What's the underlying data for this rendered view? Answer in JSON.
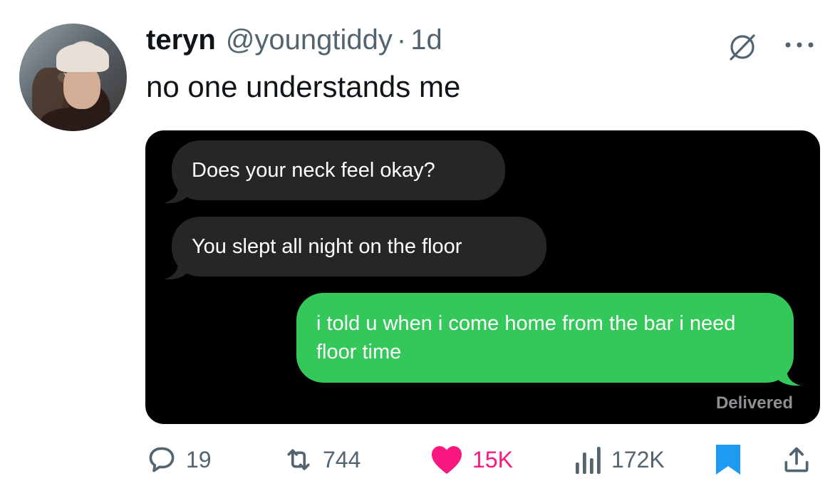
{
  "tweet": {
    "display_name": "teryn",
    "handle": "@youngtiddy",
    "separator": "·",
    "time": "1d",
    "text": "no one understands me"
  },
  "media": {
    "messages": [
      {
        "from": "them",
        "text": "Does your neck feel okay?"
      },
      {
        "from": "them",
        "text": "You slept all night on the floor"
      },
      {
        "from": "me",
        "text": "i told u when i come home from the bar i need floor time"
      }
    ],
    "status": "Delivered",
    "incoming_color": "#262628",
    "outgoing_color": "#34c759"
  },
  "actions": {
    "replies": "19",
    "reposts": "744",
    "likes": "15K",
    "views": "172K"
  },
  "icons": {
    "reply": "reply-icon",
    "repost": "repost-icon",
    "like": "heart-icon",
    "views": "views-icon",
    "bookmark": "bookmark-icon",
    "share": "share-icon",
    "grok": "grok-icon",
    "more": "more-icon"
  },
  "colors": {
    "like": "#f91880",
    "bookmark": "#1d9bf0",
    "secondary_text": "#536471"
  }
}
